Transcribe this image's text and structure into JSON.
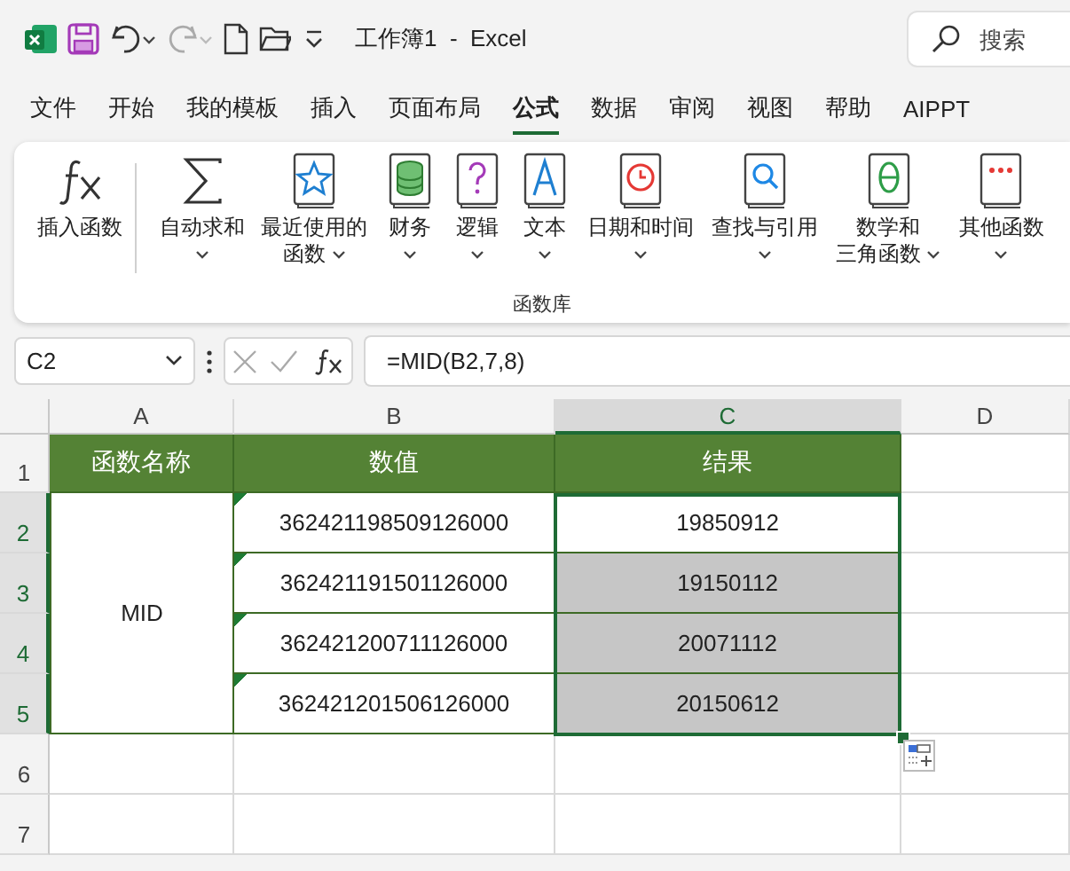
{
  "window": {
    "title": "工作簿1  -  Excel"
  },
  "search": {
    "placeholder": "搜索"
  },
  "tabs": [
    {
      "label": "文件",
      "selected": false
    },
    {
      "label": "开始",
      "selected": false
    },
    {
      "label": "我的模板",
      "selected": false
    },
    {
      "label": "插入",
      "selected": false
    },
    {
      "label": "页面布局",
      "selected": false
    },
    {
      "label": "公式",
      "selected": true
    },
    {
      "label": "数据",
      "selected": false
    },
    {
      "label": "审阅",
      "selected": false
    },
    {
      "label": "视图",
      "selected": false
    },
    {
      "label": "帮助",
      "selected": false
    },
    {
      "label": "AIPPT",
      "selected": false
    }
  ],
  "ribbon": {
    "group": "函数库",
    "buttons": [
      {
        "lines": [
          "插入函数"
        ],
        "dropdown": false
      },
      {
        "lines": [
          "自动求和"
        ],
        "dropdown": true
      },
      {
        "lines": [
          "最近使用的",
          "函数"
        ],
        "dropdown": true
      },
      {
        "lines": [
          "财务"
        ],
        "dropdown": true
      },
      {
        "lines": [
          "逻辑"
        ],
        "dropdown": true
      },
      {
        "lines": [
          "文本"
        ],
        "dropdown": true
      },
      {
        "lines": [
          "日期和时间"
        ],
        "dropdown": true
      },
      {
        "lines": [
          "查找与引用"
        ],
        "dropdown": true
      },
      {
        "lines": [
          "数学和",
          "三角函数"
        ],
        "dropdown": true
      },
      {
        "lines": [
          "其他函数"
        ],
        "dropdown": true
      }
    ]
  },
  "formula_bar": {
    "name_box": "C2",
    "formula": "=MID(B2,7,8)"
  },
  "sheet": {
    "columns": [
      {
        "label": "A",
        "selected": false
      },
      {
        "label": "B",
        "selected": false
      },
      {
        "label": "C",
        "selected": true
      },
      {
        "label": "D",
        "selected": false
      }
    ],
    "rows": [
      {
        "label": "1",
        "selected": false
      },
      {
        "label": "2",
        "selected": true
      },
      {
        "label": "3",
        "selected": true
      },
      {
        "label": "4",
        "selected": true
      },
      {
        "label": "5",
        "selected": true
      },
      {
        "label": "6",
        "selected": false
      },
      {
        "label": "7",
        "selected": false
      }
    ],
    "header": [
      "函数名称",
      "数值",
      "结果"
    ],
    "merged_name": "MID",
    "data": [
      {
        "value": "362421198509126000",
        "flag": true,
        "result": "19850912",
        "selected": false
      },
      {
        "value": "362421191501126000",
        "flag": true,
        "result": "19150112",
        "selected": true
      },
      {
        "value": "362421200711126000",
        "flag": true,
        "result": "20071112",
        "selected": true
      },
      {
        "value": "362421201506126000",
        "flag": true,
        "result": "20150612",
        "selected": true
      }
    ]
  }
}
